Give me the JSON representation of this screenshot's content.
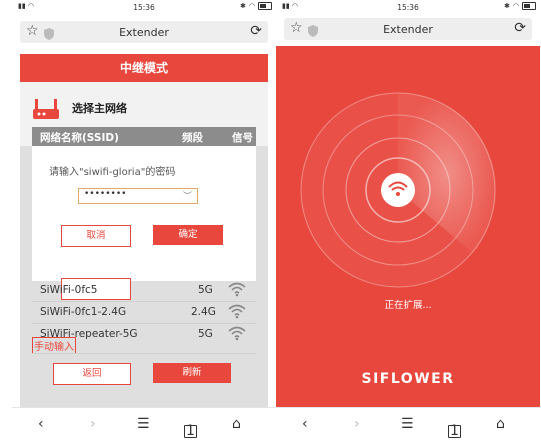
{
  "colors": {
    "accent": "#e8473d",
    "background": "#f2f2f2"
  },
  "left": {
    "status": {
      "signal": "≅il ≅",
      "time": "15:36",
      "icons": "✱ ≈ ▭"
    },
    "browser": {
      "title": "Extender"
    },
    "page_title": "中继模式",
    "section_title": "选择主网络",
    "table": {
      "headers": [
        "网络名称(SSID)",
        "频段",
        "信号"
      ]
    },
    "dialog": {
      "prompt": "请输入\"siwifi-gloria\"的密码",
      "password_value": "••••••••",
      "cancel_label": "取消",
      "confirm_label": "确定"
    },
    "networks": [
      {
        "ssid": "SiWiFi-0fc5",
        "band": "5G"
      },
      {
        "ssid": "SiWiFi-0fc1-2.4G",
        "band": "2.4G"
      },
      {
        "ssid": "SiWiFi-repeater-5G",
        "band": "5G"
      }
    ],
    "manual_label": "手动输入",
    "back_label": "返回",
    "refresh_label": "刷新",
    "nav": {
      "back": "‹",
      "forward": "›",
      "menu": "☰",
      "tabs": "1",
      "home": "⌂"
    }
  },
  "right": {
    "status": {
      "signal": "≅il ≅",
      "time": "15:36",
      "icons": "✱ ≈ ▭"
    },
    "browser": {
      "title": "Extender"
    },
    "status_text": "正在扩展...",
    "brand": "SIFLOWER",
    "nav": {
      "back": "‹",
      "forward": "›",
      "menu": "☰",
      "tabs": "1",
      "home": "⌂"
    }
  }
}
